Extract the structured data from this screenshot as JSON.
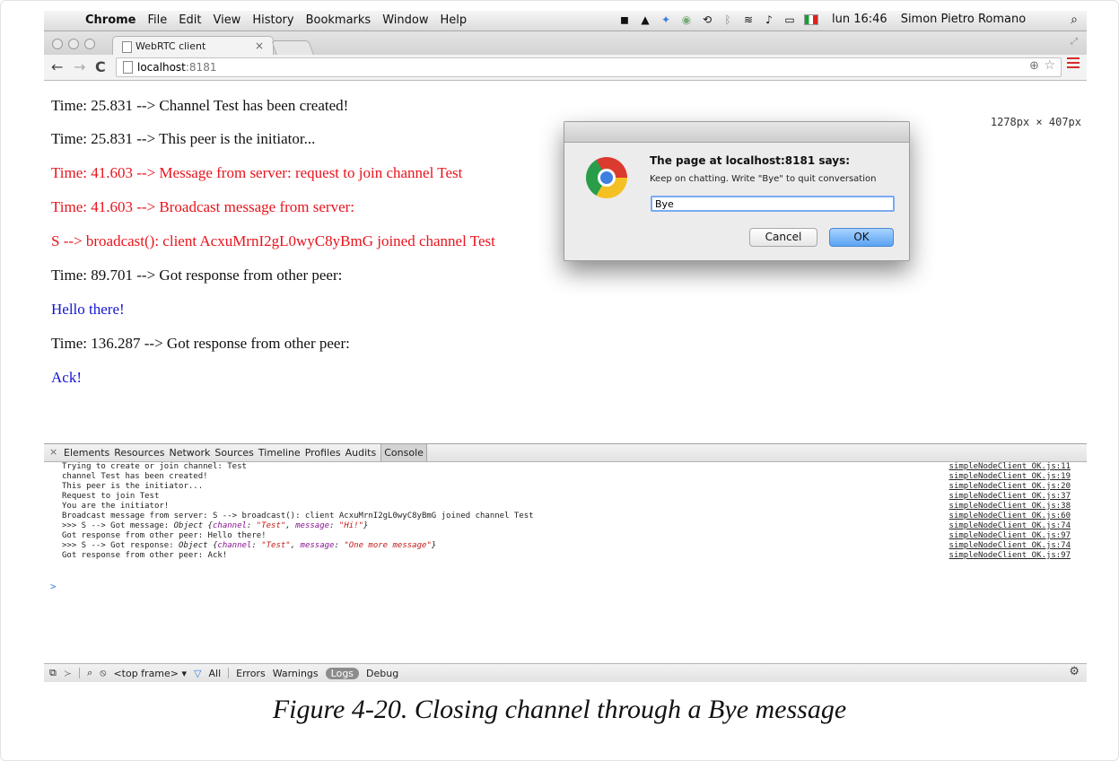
{
  "menubar": {
    "app": "Chrome",
    "menus": [
      "File",
      "Edit",
      "View",
      "History",
      "Bookmarks",
      "Window",
      "Help"
    ],
    "clock": "lun 16:46",
    "user": "Simon Pietro Romano"
  },
  "tab": {
    "title": "WebRTC client",
    "close": "×"
  },
  "toolbar": {
    "host": "localhost",
    "port": ":8181"
  },
  "page": {
    "dimensions": "1278px × 407px",
    "lines": [
      {
        "text": "Time: 25.831 --> Channel Test has been created!",
        "color": "black"
      },
      {
        "text": "Time: 25.831 --> This peer is the initiator...",
        "color": "black"
      },
      {
        "text": "Time: 41.603 --> Message from server: request to join channel Test",
        "color": "red"
      },
      {
        "text": "Time: 41.603 --> Broadcast message from server:",
        "color": "red"
      },
      {
        "text": "S --> broadcast(): client AcxuMrnI2gL0wyC8yBmG joined channel Test",
        "color": "red"
      },
      {
        "text": "Time: 89.701 --> Got response from other peer:",
        "color": "black"
      },
      {
        "text": "Hello there!",
        "color": "blue"
      },
      {
        "text": "Time: 136.287 --> Got response from other peer:",
        "color": "black"
      },
      {
        "text": "Ack!",
        "color": "blue"
      }
    ]
  },
  "dialog": {
    "title": "The page at localhost:8181 says:",
    "message": "Keep on chatting. Write \"Bye\" to quit conversation",
    "input_value": "Bye",
    "cancel_label": "Cancel",
    "ok_label": "OK"
  },
  "devtools": {
    "close": "×",
    "tabs": [
      "Elements",
      "Resources",
      "Network",
      "Sources",
      "Timeline",
      "Profiles",
      "Audits",
      "Console"
    ],
    "active_tab": "Console",
    "console": [
      {
        "msg": "Trying to create or join channel:  Test",
        "src": "simpleNodeClient_OK.js:11"
      },
      {
        "msg": "channel Test has been created!",
        "src": "simpleNodeClient_OK.js:19"
      },
      {
        "msg": "This peer is the initiator...",
        "src": "simpleNodeClient_OK.js:20"
      },
      {
        "msg": "Request to join Test",
        "src": "simpleNodeClient_OK.js:37"
      },
      {
        "msg": "You are the initiator!",
        "src": "simpleNodeClient_OK.js:38"
      },
      {
        "msg": "Broadcast message from server: S --> broadcast(): client AcxuMrnI2gL0wyC8yBmG joined channel Test",
        "src": "simpleNodeClient_OK.js:60"
      },
      {
        "prefix": ">>>  S --> Got message:  ",
        "obj": "Object {",
        "k1": "channel",
        "v1": "\"Test\"",
        "k2": "message",
        "v2": "\"Hi!\"",
        "end": "}",
        "src": "simpleNodeClient_OK.js:74"
      },
      {
        "msg": "Got response from other peer: Hello there!",
        "src": "simpleNodeClient_OK.js:97"
      },
      {
        "prefix": ">>>  S --> Got response:  ",
        "obj": "Object {",
        "k1": "channel",
        "v1": "\"Test\"",
        "k2": "message",
        "v2": "\"One more message\"",
        "end": "}",
        "src": "simpleNodeClient_OK.js:74"
      },
      {
        "msg": "Got response from other peer: Ack!",
        "src": "simpleNodeClient_OK.js:97"
      }
    ],
    "prompt": ">",
    "bottom": {
      "frame": "<top frame> ▾",
      "filters": [
        "All",
        "Errors",
        "Warnings",
        "Logs",
        "Debug"
      ]
    }
  },
  "caption": "Figure 4-20. Closing channel through a Bye message",
  "colors": {
    "red": "#e8131c",
    "blue": "#1515d6",
    "black": "#111111"
  }
}
